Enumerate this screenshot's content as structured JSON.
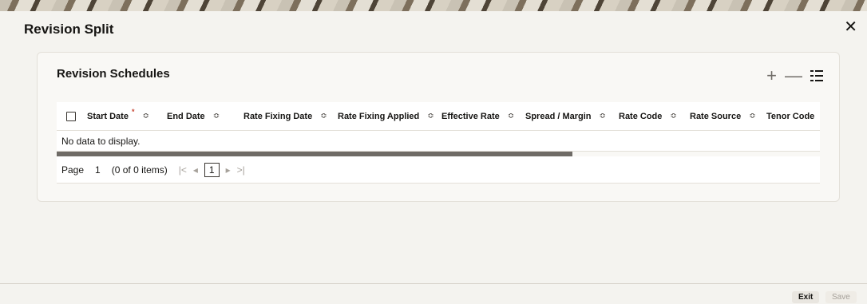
{
  "dialog": {
    "title": "Revision Split",
    "close_glyph": "✕"
  },
  "section": {
    "title": "Revision Schedules"
  },
  "toolbar": {
    "add_glyph": "+",
    "remove_glyph": "—"
  },
  "grid": {
    "columns": [
      {
        "label": "Start Date",
        "required": true,
        "sortable": true
      },
      {
        "label": "End Date",
        "sortable": true
      },
      {
        "label": "Rate Fixing Date",
        "sortable": true
      },
      {
        "label": "Rate Fixing Applied",
        "sortable": true
      },
      {
        "label": "Effective Rate",
        "sortable": true
      },
      {
        "label": "Spread / Margin",
        "sortable": true
      },
      {
        "label": "Rate Code",
        "sortable": true
      },
      {
        "label": "Rate Source",
        "sortable": true
      },
      {
        "label": "Tenor Code",
        "sortable": false
      }
    ],
    "required_mark": "*",
    "sort_glyph": "≎",
    "empty_text": "No data to display."
  },
  "pager": {
    "page_label": "Page",
    "page_value": "1",
    "items_text": "(0 of 0 items)",
    "first_glyph": "|<",
    "prev_glyph": "◂",
    "current_page": "1",
    "next_glyph": "▸",
    "last_glyph": ">|"
  },
  "footer": {
    "exit_label": "Exit",
    "save_label": "Save"
  },
  "colors": {
    "required": "#c74634",
    "accent": "#161513"
  }
}
